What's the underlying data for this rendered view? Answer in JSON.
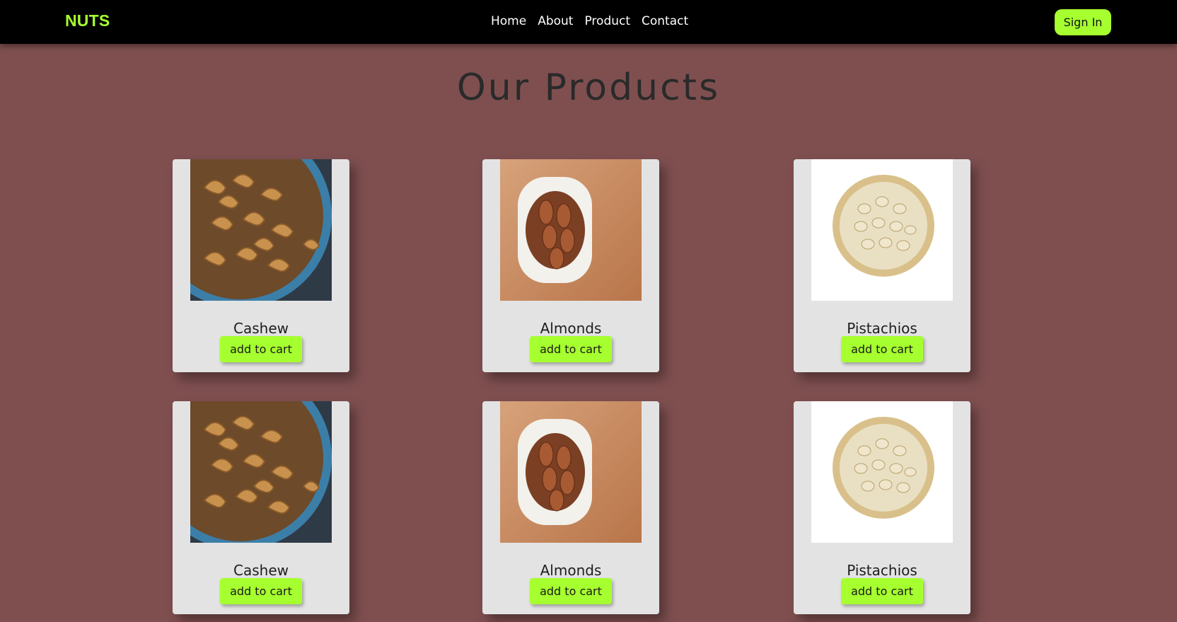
{
  "nav": {
    "brand": "NUTS",
    "links": [
      "Home",
      "About",
      "Product",
      "Contact"
    ],
    "signin": "Sign In"
  },
  "main": {
    "title": "Our Products",
    "products": [
      {
        "name": "Cashew",
        "button": "add to cart"
      },
      {
        "name": "Almonds",
        "button": "add to cart"
      },
      {
        "name": "Pistachios",
        "button": "add to cart"
      },
      {
        "name": "Cashew",
        "button": "add to cart"
      },
      {
        "name": "Almonds",
        "button": "add to cart"
      },
      {
        "name": "Pistachios",
        "button": "add to cart"
      }
    ]
  },
  "colors": {
    "background": "#7f4f50",
    "navbar": "#000000",
    "accent": "#a6ff2e",
    "card": "#e3e3e3"
  }
}
